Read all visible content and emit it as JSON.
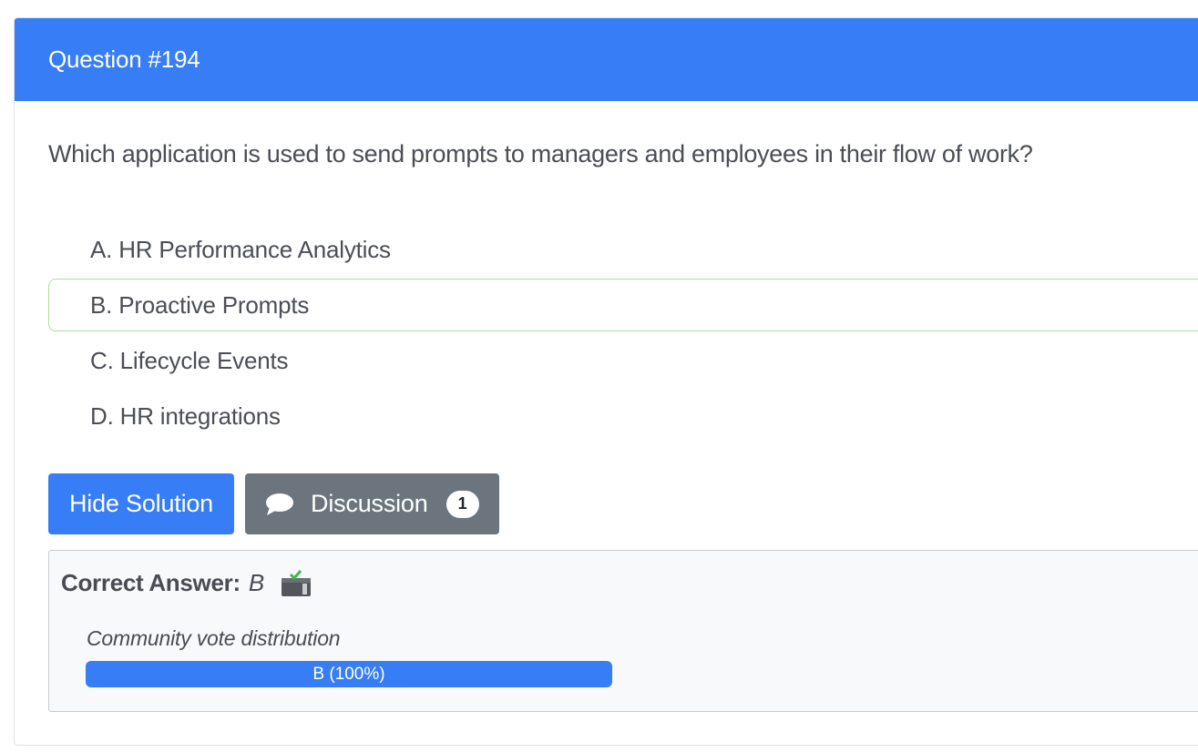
{
  "question": {
    "title": "Question #194",
    "text": "Which application is used to send prompts to managers and employees in their flow of work?"
  },
  "choices": [
    {
      "label": "A. HR Performance Analytics",
      "correct": false
    },
    {
      "label": "B. Proactive Prompts",
      "correct": true
    },
    {
      "label": "C. Lifecycle Events",
      "correct": false
    },
    {
      "label": "D. HR integrations",
      "correct": false
    }
  ],
  "buttons": {
    "hide_solution": "Hide Solution",
    "discussion": "Discussion",
    "discussion_count": "1"
  },
  "answer": {
    "label": "Correct Answer:",
    "value": "B",
    "vote_label": "Community vote distribution",
    "votes": [
      {
        "text": "B (100%)",
        "percent": 100
      }
    ]
  },
  "colors": {
    "primary": "#377df6",
    "secondary": "#6c757d",
    "correct_border": "#a3e39b"
  },
  "icons": {
    "discussion": "chat-bubble-icon",
    "reveal": "answer-reveal-icon"
  }
}
